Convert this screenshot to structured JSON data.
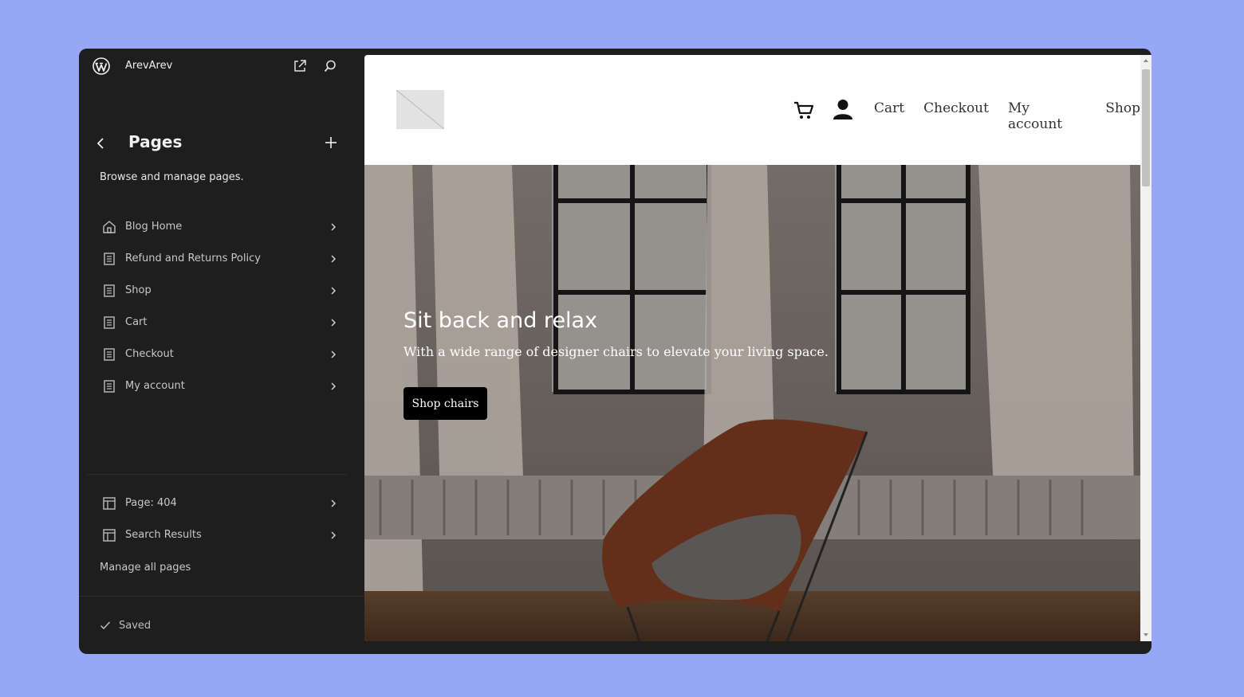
{
  "sidebar": {
    "site_name": "ArevArev",
    "title": "Pages",
    "description": "Browse and manage pages.",
    "pages": [
      {
        "label": "Blog Home",
        "icon": "home-icon"
      },
      {
        "label": "Refund and Returns Policy",
        "icon": "page-icon"
      },
      {
        "label": "Shop",
        "icon": "page-icon"
      },
      {
        "label": "Cart",
        "icon": "page-icon"
      },
      {
        "label": "Checkout",
        "icon": "page-icon"
      },
      {
        "label": "My account",
        "icon": "page-icon"
      }
    ],
    "templates": [
      {
        "label": "Page: 404",
        "icon": "layout-icon"
      },
      {
        "label": "Search Results",
        "icon": "layout-icon"
      }
    ],
    "manage_link": "Manage all pages",
    "status": "Saved"
  },
  "preview": {
    "nav": [
      "Cart",
      "Checkout",
      "My account",
      "Shop"
    ],
    "hero": {
      "title": "Sit back and relax",
      "subtitle": "With a wide range of designer chairs to elevate your living space.",
      "button": "Shop chairs"
    }
  },
  "colors": {
    "window_bg": "#1e1e1e",
    "page_bg": "#95a7f5",
    "button_bg": "#000000"
  }
}
